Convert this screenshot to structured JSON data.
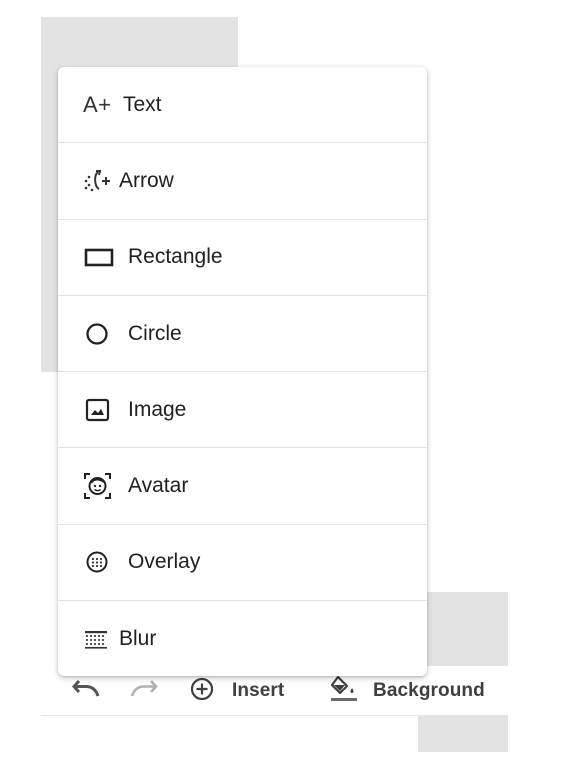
{
  "menu": {
    "items": [
      {
        "label": "Text",
        "icon": "text-add-icon"
      },
      {
        "label": "Arrow",
        "icon": "arrow-draw-icon"
      },
      {
        "label": "Rectangle",
        "icon": "rectangle-icon"
      },
      {
        "label": "Circle",
        "icon": "circle-icon"
      },
      {
        "label": "Image",
        "icon": "image-icon"
      },
      {
        "label": "Avatar",
        "icon": "avatar-icon"
      },
      {
        "label": "Overlay",
        "icon": "overlay-icon"
      },
      {
        "label": "Blur",
        "icon": "blur-icon"
      }
    ],
    "text_icon_glyph": "A+"
  },
  "toolbar": {
    "undo_icon": "undo-icon",
    "redo_icon": "redo-icon",
    "insert_label": "Insert",
    "insert_icon": "add-circle-icon",
    "background_label": "Background",
    "background_icon": "paint-bucket-icon"
  },
  "colors": {
    "icon": "#333333",
    "toolbar_text": "#3c4043",
    "disabled_icon": "#b0b0b0",
    "backdrop": "#e3e3e3"
  }
}
